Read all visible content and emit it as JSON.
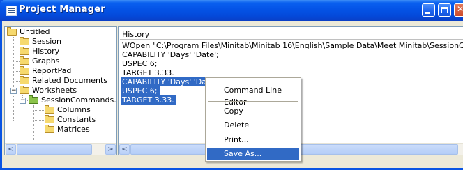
{
  "window": {
    "title": "Project Manager"
  },
  "tree": {
    "items": [
      {
        "label": "Untitled",
        "kind": "folder"
      },
      {
        "label": "Session",
        "kind": "folder"
      },
      {
        "label": "History",
        "kind": "folder"
      },
      {
        "label": "Graphs",
        "kind": "folder"
      },
      {
        "label": "ReportPad",
        "kind": "folder"
      },
      {
        "label": "Related Documents",
        "kind": "folder"
      },
      {
        "label": "Worksheets",
        "kind": "folder"
      },
      {
        "label": "SessionCommands.M",
        "kind": "worksheet"
      },
      {
        "label": "Columns",
        "kind": "folder"
      },
      {
        "label": "Constants",
        "kind": "folder"
      },
      {
        "label": "Matrices",
        "kind": "folder"
      }
    ],
    "collapse_glyph": "−"
  },
  "history": {
    "header": "History",
    "lines": [
      {
        "text": "WOpen \"C:\\Program Files\\Minitab\\Minitab 16\\English\\Sample Data\\Meet Minitab\\SessionCommands.MTW\"."
      },
      {
        "text": "CAPABILITY 'Days' 'Date';"
      },
      {
        "text": "USPEC 6;"
      },
      {
        "text": "TARGET 3.33."
      },
      {
        "text": "CAPABILITY 'Days' 'Date';",
        "selected": true
      },
      {
        "text": "USPEC 6;",
        "selected": true
      },
      {
        "text": "TARGET 3.33.",
        "selected": true
      }
    ]
  },
  "context_menu": {
    "items": [
      {
        "label": "Command Line Editor"
      },
      {
        "label": "Copy"
      },
      {
        "label": "Delete"
      },
      {
        "label": "Print..."
      },
      {
        "label": "Save As..."
      }
    ],
    "highlighted": "Save As..."
  },
  "scrollbar": {
    "left_arrow": "<",
    "right_arrow": ">"
  },
  "colors": {
    "titlebar": "#0453e6",
    "selection": "#316ac5",
    "chrome": "#ece9d8"
  }
}
